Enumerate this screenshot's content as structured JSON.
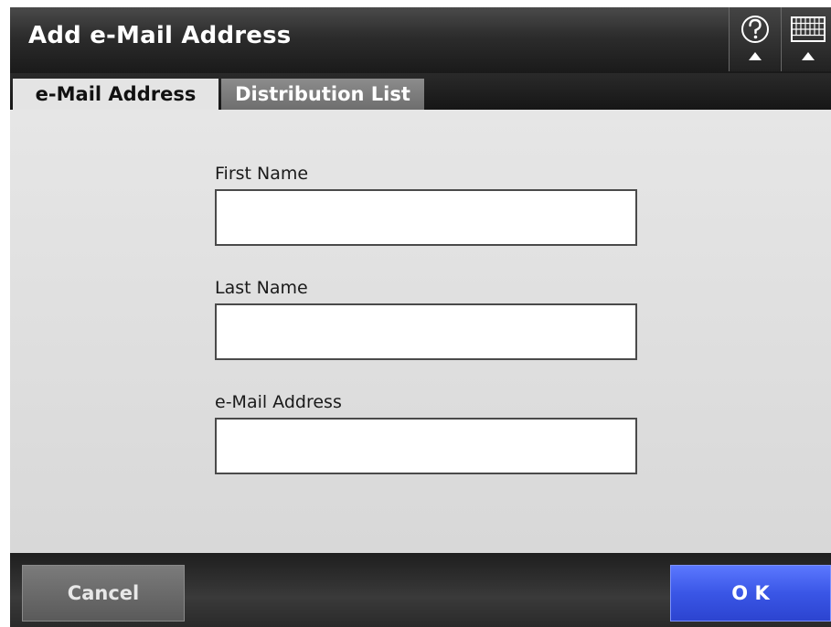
{
  "window": {
    "title": "Add e-Mail Address"
  },
  "toolbar": {
    "help_icon": "help-question-icon",
    "keyboard_icon": "keyboard-icon"
  },
  "tabs": [
    {
      "label": "e-Mail Address",
      "active": true
    },
    {
      "label": "Distribution List",
      "active": false
    }
  ],
  "form": {
    "first_name": {
      "label": "First Name",
      "value": ""
    },
    "last_name": {
      "label": "Last Name",
      "value": ""
    },
    "email": {
      "label": "e-Mail Address",
      "value": ""
    }
  },
  "footer": {
    "cancel_label": "Cancel",
    "ok_label": "O K"
  },
  "colors": {
    "ok_accent": "#3a56e6",
    "content_bg": "#e2e2e2",
    "header_bg": "#2c2c2c"
  }
}
